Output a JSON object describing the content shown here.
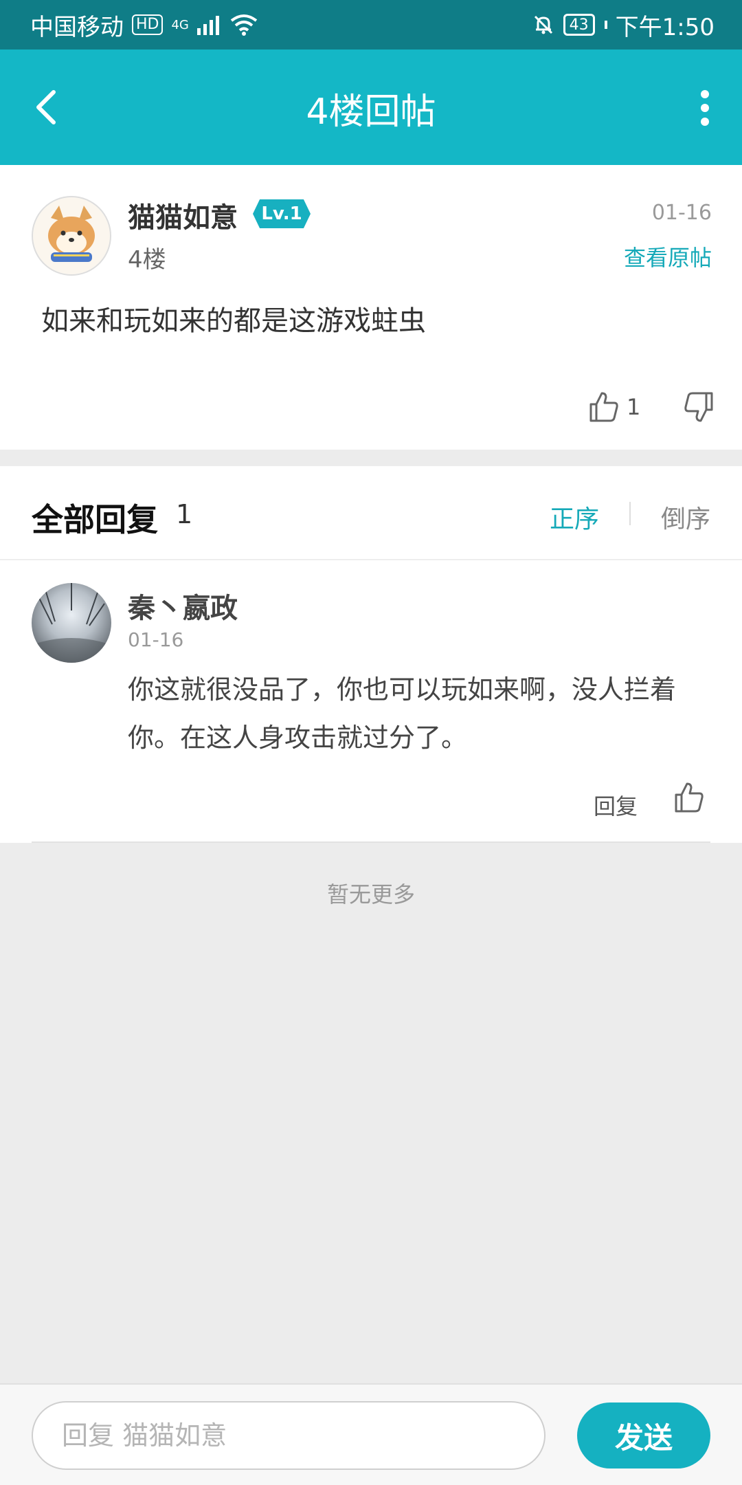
{
  "status_bar": {
    "carrier": "中国移动",
    "hd_badge": "HD",
    "network": "4G",
    "battery": "43",
    "time": "下午1:50"
  },
  "header": {
    "title": "4楼回帖"
  },
  "post": {
    "username": "猫猫如意",
    "level": "Lv.1",
    "floor": "4楼",
    "date": "01-16",
    "view_original": "查看原帖",
    "content": "如来和玩如来的都是这游戏蛀虫",
    "like_count": "1"
  },
  "replies": {
    "title": "全部回复",
    "count": "1",
    "sort_asc": "正序",
    "sort_desc": "倒序",
    "items": [
      {
        "username": "秦丶嬴政",
        "date": "01-16",
        "content": "你这就很没品了，你也可以玩如来啊，没人拦着你。在这人身攻击就过分了。",
        "reply_label": "回复"
      }
    ]
  },
  "no_more": "暂无更多",
  "composer": {
    "placeholder": "回复 猫猫如意",
    "send_label": "发送"
  },
  "colors": {
    "accent": "#14b7c6",
    "status_bar": "#0f7d87",
    "link": "#15a9b8"
  }
}
